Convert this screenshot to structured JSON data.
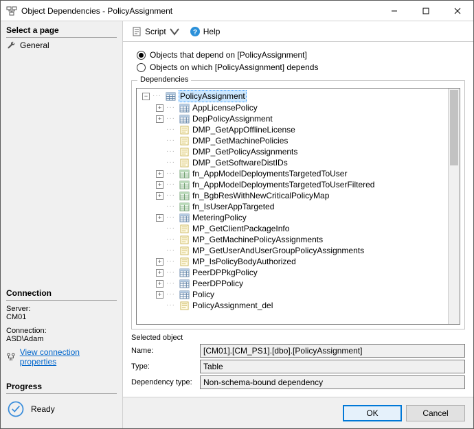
{
  "window": {
    "title": "Object Dependencies - PolicyAssignment"
  },
  "left": {
    "select_page": "Select a page",
    "general": "General",
    "connection": "Connection",
    "server_label": "Server:",
    "server_value": "CM01",
    "conn_label": "Connection:",
    "conn_value": "ASD\\Adam",
    "view_props": "View connection properties",
    "progress": "Progress",
    "ready": "Ready"
  },
  "toolbar": {
    "script": "Script",
    "help": "Help"
  },
  "radios": {
    "opt1": "Objects that depend on [PolicyAssignment]",
    "opt2": "Objects on which [PolicyAssignment] depends"
  },
  "group": {
    "legend": "Dependencies"
  },
  "tree": [
    {
      "depth": 0,
      "exp": "minus",
      "icon": "table",
      "label": "PolicyAssignment",
      "selected": true
    },
    {
      "depth": 1,
      "exp": "plus",
      "icon": "table",
      "label": "AppLicensePolicy"
    },
    {
      "depth": 1,
      "exp": "plus",
      "icon": "table",
      "label": "DepPolicyAssignment"
    },
    {
      "depth": 1,
      "exp": "none",
      "icon": "proc",
      "label": "DMP_GetAppOfflineLicense"
    },
    {
      "depth": 1,
      "exp": "none",
      "icon": "proc",
      "label": "DMP_GetMachinePolicies"
    },
    {
      "depth": 1,
      "exp": "none",
      "icon": "proc",
      "label": "DMP_GetPolicyAssignments"
    },
    {
      "depth": 1,
      "exp": "none",
      "icon": "proc",
      "label": "DMP_GetSoftwareDistIDs"
    },
    {
      "depth": 1,
      "exp": "plus",
      "icon": "func",
      "label": "fn_AppModelDeploymentsTargetedToUser"
    },
    {
      "depth": 1,
      "exp": "plus",
      "icon": "func",
      "label": "fn_AppModelDeploymentsTargetedToUserFiltered"
    },
    {
      "depth": 1,
      "exp": "plus",
      "icon": "func",
      "label": "fn_BgbResWithNewCriticalPolicyMap"
    },
    {
      "depth": 1,
      "exp": "none",
      "icon": "func",
      "label": "fn_IsUserAppTargeted"
    },
    {
      "depth": 1,
      "exp": "plus",
      "icon": "table",
      "label": "MeteringPolicy"
    },
    {
      "depth": 1,
      "exp": "none",
      "icon": "proc",
      "label": "MP_GetClientPackageInfo"
    },
    {
      "depth": 1,
      "exp": "none",
      "icon": "proc",
      "label": "MP_GetMachinePolicyAssignments"
    },
    {
      "depth": 1,
      "exp": "none",
      "icon": "proc",
      "label": "MP_GetUserAndUserGroupPolicyAssignments"
    },
    {
      "depth": 1,
      "exp": "plus",
      "icon": "proc",
      "label": "MP_IsPolicyBodyAuthorized"
    },
    {
      "depth": 1,
      "exp": "plus",
      "icon": "table",
      "label": "PeerDPPkgPolicy"
    },
    {
      "depth": 1,
      "exp": "plus",
      "icon": "table",
      "label": "PeerDPPolicy"
    },
    {
      "depth": 1,
      "exp": "plus",
      "icon": "table",
      "label": "Policy"
    },
    {
      "depth": 1,
      "exp": "none",
      "icon": "proc",
      "label": "PolicyAssignment_del"
    }
  ],
  "selected": {
    "heading": "Selected object",
    "name_label": "Name:",
    "name_value": "[CM01].[CM_PS1].[dbo].[PolicyAssignment]",
    "type_label": "Type:",
    "type_value": "Table",
    "dep_label": "Dependency type:",
    "dep_value": "Non-schema-bound dependency"
  },
  "footer": {
    "ok": "OK",
    "cancel": "Cancel"
  }
}
